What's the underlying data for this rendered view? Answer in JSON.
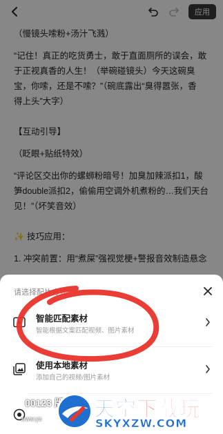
{
  "toolbar": {
    "apply_label": "应用"
  },
  "document": {
    "lines": [
      "（慢镜头嗦粉+汤汁飞溅）",
      "“记住！真正的吃货勇士，敢于直面厕所的误会，敢",
      "于正视真香的人生！（举碗碰镜头）今天这碗臭",
      "宝，你嗦，还是不嗦？”（碗底露出“臭得嚣张，香",
      "得上头”大字）",
      "【互动引导】",
      "（眨眼+贴纸特效）",
      "“评论区交出你的螺蛳粉暗号！加臭加辣派扣1，酸",
      "笋double派扣2，偷偷用空调外机煮粉的…我们天台",
      "见！”（坏笑音效）",
      "✨ 技巧应用：",
      "1. 冲突前置：用“煮屎”强视觉梗+警报音效制造悬念"
    ]
  },
  "sheet": {
    "title": "请选择配片方式",
    "options": [
      {
        "label": "智能匹配素材",
        "desc": "智能根据文案匹配视频、图片素材"
      },
      {
        "label": "使用本地素材",
        "desc": "添加自己的视频/图片素材"
      },
      {
        "label": "",
        "desc": ""
      }
    ]
  },
  "watermark": {
    "left_text": "00123 版本",
    "url_text": "www.ys",
    "title_main": "天空",
    "title_accent": "下载玩",
    "domain": "SKYXZW.COM"
  },
  "colors": {
    "overlay": "#000000",
    "annotation_stroke": "#e8332a",
    "apply_button": "#3a3a3a",
    "watermark_blue": "#1f6fd1",
    "watermark_red": "#e13a2e"
  }
}
